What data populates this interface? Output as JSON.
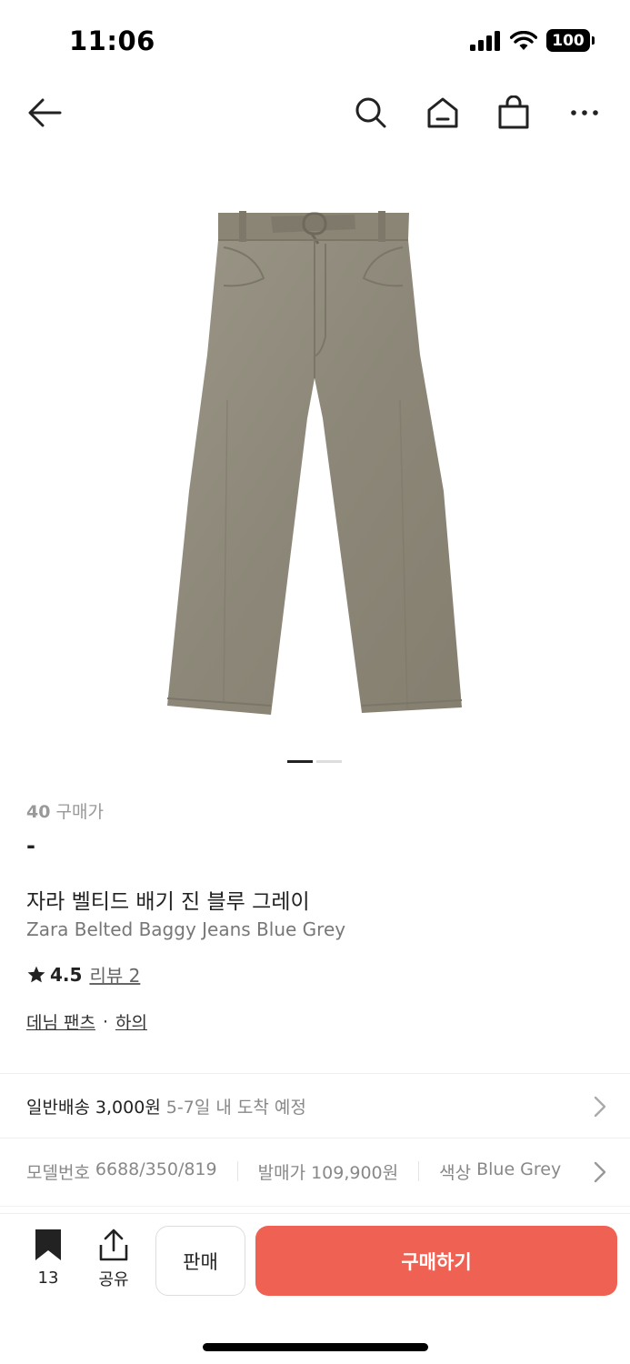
{
  "status_bar": {
    "time": "11:06",
    "battery": "100"
  },
  "product": {
    "buyers_count": "40",
    "buyers_label": "구매가",
    "price": "-",
    "title_ko": "자라 벨티드 배기 진 블루 그레이",
    "title_en": "Zara Belted Baggy Jeans Blue Grey",
    "rating": "4.5",
    "review_label": "리뷰 2",
    "category": {
      "primary": "데님 팬츠",
      "separator": "·",
      "secondary": "하의"
    },
    "image_count": 2,
    "image_index": 1
  },
  "shipping": {
    "type": "일반배송",
    "fee": "3,000원",
    "eta": "5-7일 내 도착 예정"
  },
  "specs": [
    {
      "label": "모델번호",
      "value": "6688/350/819"
    },
    {
      "label": "발매가",
      "value": "109,900원"
    },
    {
      "label": "색상",
      "value": "Blue Grey"
    }
  ],
  "bottom_bar": {
    "bookmark_count": "13",
    "share_label": "공유",
    "sell_label": "판매",
    "buy_label": "구매하기"
  },
  "colors": {
    "accent": "#ef6253",
    "denim": "#8f8a7c"
  }
}
